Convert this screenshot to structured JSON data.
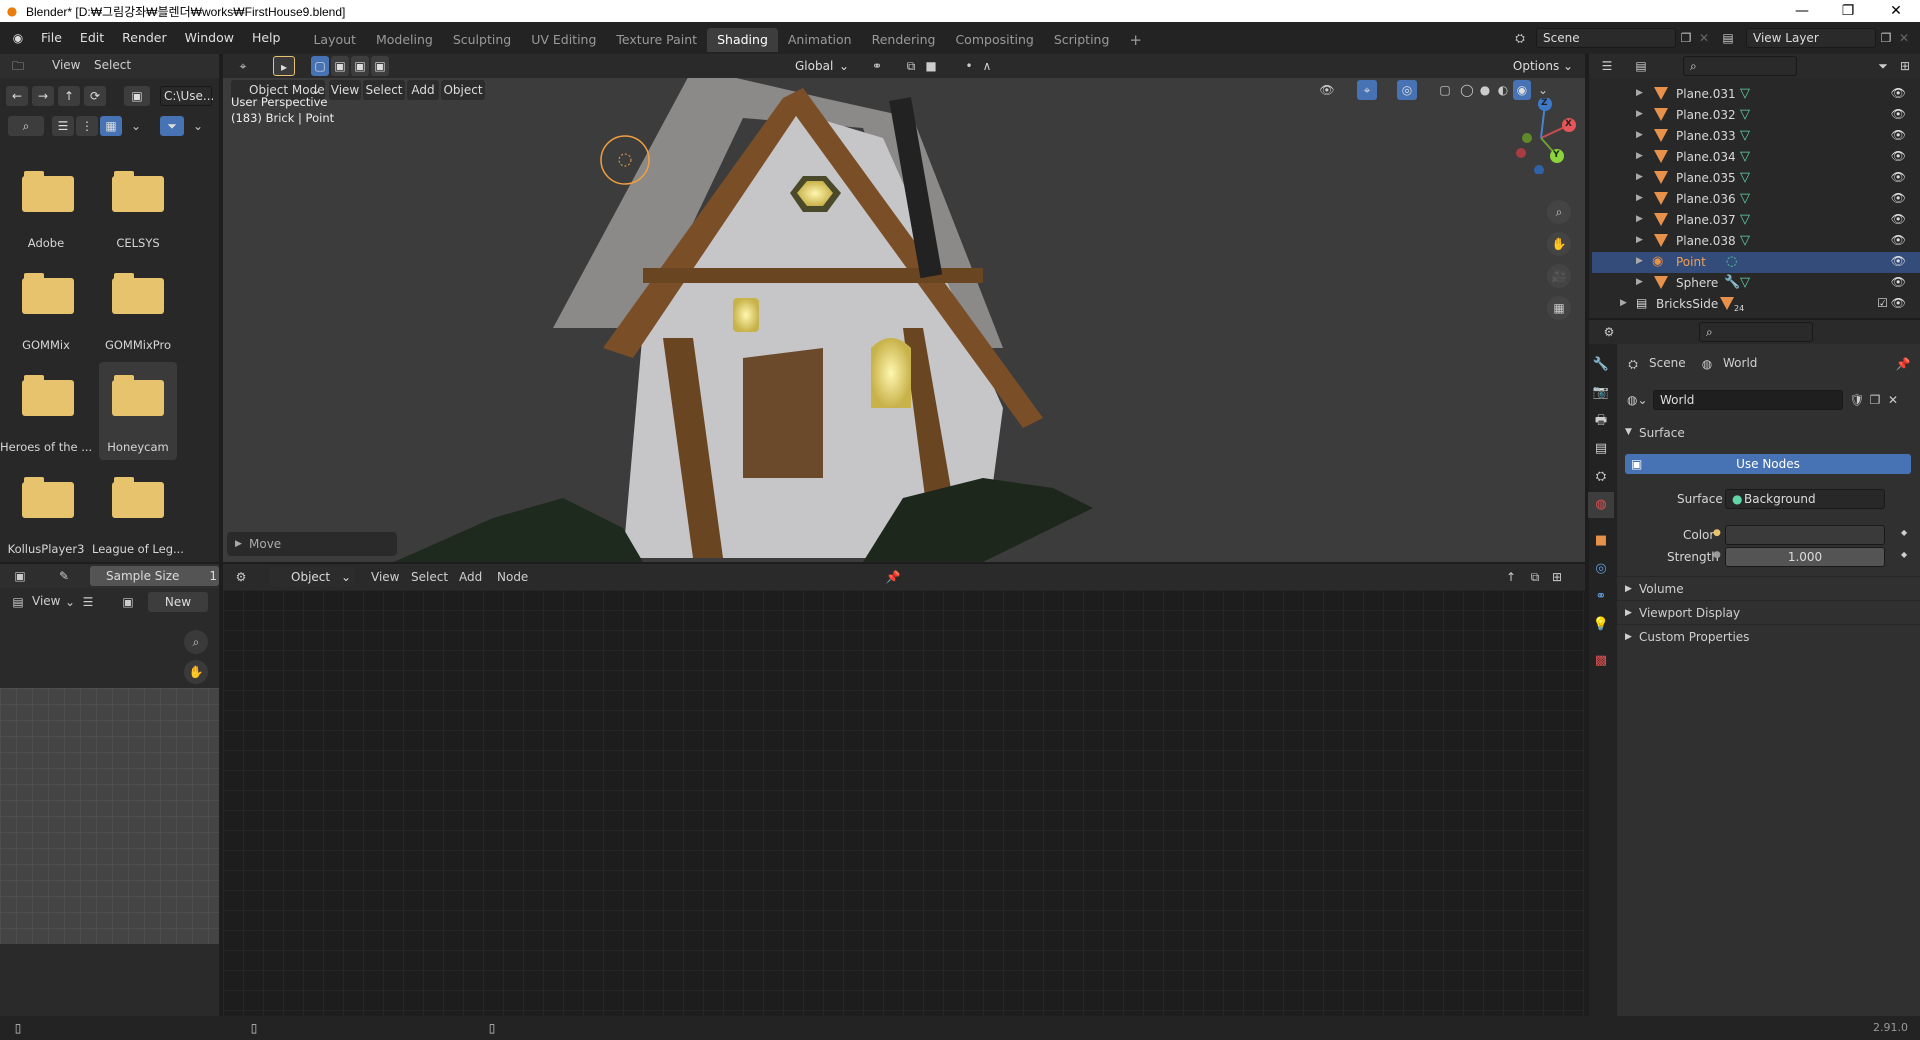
{
  "window": {
    "title": "Blender* [D:₩그림강좌₩블렌더₩works₩FirstHouse9.blend]",
    "minimize": "—",
    "maximize": "❐",
    "close": "✕"
  },
  "menubar": {
    "items": [
      "File",
      "Edit",
      "Render",
      "Window",
      "Help"
    ]
  },
  "workspaces": {
    "tabs": [
      "Layout",
      "Modeling",
      "Sculpting",
      "UV Editing",
      "Texture Paint",
      "Shading",
      "Animation",
      "Rendering",
      "Compositing",
      "Scripting"
    ],
    "active": "Shading",
    "add": "+"
  },
  "scene_selector": {
    "value": "Scene"
  },
  "view_layer_selector": {
    "value": "View Layer"
  },
  "file_browser": {
    "menus": [
      "View",
      "Select"
    ],
    "path": "C:\\Use...",
    "folders": [
      "Adobe",
      "CELSYS",
      "GOMMix",
      "GOMMixPro",
      "Heroes of the ...",
      "Honeycam",
      "KollusPlayer3",
      "League of Leg..."
    ],
    "selected": "Honeycam"
  },
  "viewport": {
    "mode": "Object Mode",
    "menus": [
      "View",
      "Select",
      "Add",
      "Object"
    ],
    "orientation": "Global",
    "options": "Options",
    "info_line1": "User Perspective",
    "info_line2": "(183) Brick | Point",
    "last_op": "Move",
    "axis_x": "X",
    "axis_y": "Y",
    "axis_z": "Z"
  },
  "image_editor": {
    "sample_label": "Sample Size",
    "sample_value": "1",
    "view": "View",
    "new_button": "New"
  },
  "node_editor": {
    "type": "Object",
    "menus": [
      "View",
      "Select",
      "Add",
      "Node"
    ]
  },
  "outliner": {
    "rows": [
      {
        "name": "Plane.031",
        "kind": "mesh"
      },
      {
        "name": "Plane.032",
        "kind": "mesh"
      },
      {
        "name": "Plane.033",
        "kind": "mesh"
      },
      {
        "name": "Plane.034",
        "kind": "mesh"
      },
      {
        "name": "Plane.035",
        "kind": "mesh"
      },
      {
        "name": "Plane.036",
        "kind": "mesh"
      },
      {
        "name": "Plane.037",
        "kind": "mesh"
      },
      {
        "name": "Plane.038",
        "kind": "mesh"
      },
      {
        "name": "Point",
        "kind": "light"
      },
      {
        "name": "Sphere",
        "kind": "mesh"
      }
    ],
    "collection": {
      "name": "BricksSide",
      "count": "24"
    },
    "selected": "Point"
  },
  "properties": {
    "breadcrumb_scene": "Scene",
    "breadcrumb_world": "World",
    "world_name": "World",
    "surface_panel": "Surface",
    "use_nodes": "Use Nodes",
    "surface_label": "Surface",
    "surface_value": "Background",
    "color_label": "Color",
    "strength_label": "Strength",
    "strength_value": "1.000",
    "panels": [
      "Volume",
      "Viewport Display",
      "Custom Properties"
    ]
  },
  "statusbar": {
    "version": "2.91.0"
  },
  "colors": {
    "accent_blue": "#4772b3",
    "selection": "#334c7a",
    "folder": "#e7c36e",
    "mesh_icon": "#e7914a",
    "active_text": "#f0a050"
  }
}
